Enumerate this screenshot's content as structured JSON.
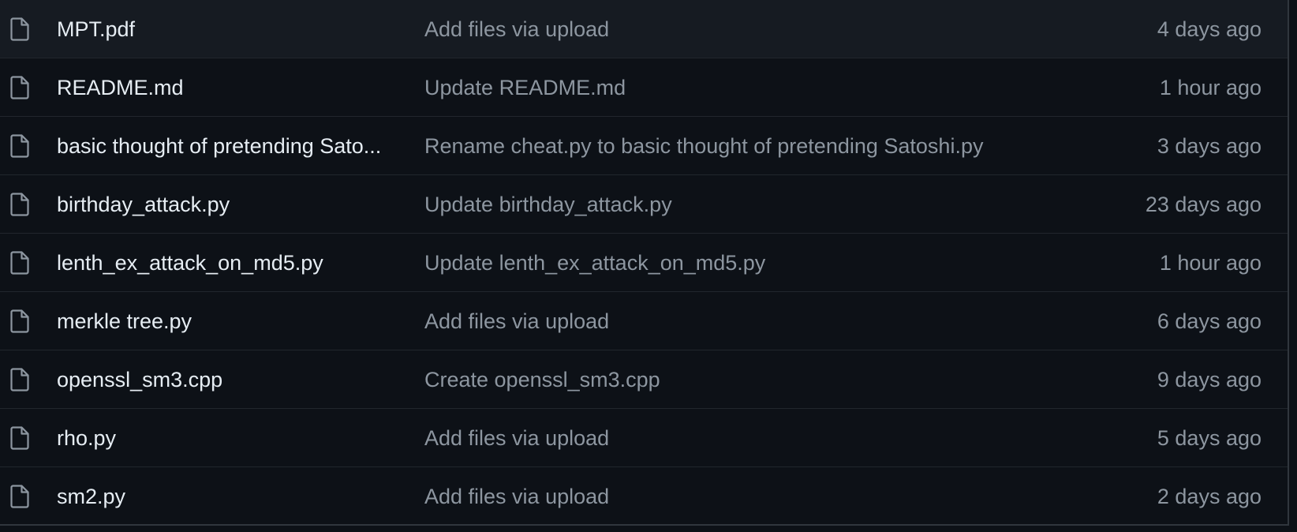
{
  "colors": {
    "background": "#0d1117",
    "row_border": "#21262d",
    "file_name": "#e6edf3",
    "muted_text": "#8d96a0",
    "icon": "#8d96a0"
  },
  "file_icon": "file-icon",
  "files": [
    {
      "name": "MPT.pdf",
      "commit": "Add files via upload",
      "age": "4 days ago"
    },
    {
      "name": "README.md",
      "commit": "Update README.md",
      "age": "1 hour ago"
    },
    {
      "name": "basic thought of pretending Sato...",
      "commit": "Rename cheat.py to basic thought of pretending Satoshi.py",
      "age": "3 days ago"
    },
    {
      "name": "birthday_attack.py",
      "commit": "Update birthday_attack.py",
      "age": "23 days ago"
    },
    {
      "name": "lenth_ex_attack_on_md5.py",
      "commit": "Update lenth_ex_attack_on_md5.py",
      "age": "1 hour ago"
    },
    {
      "name": "merkle tree.py",
      "commit": "Add files via upload",
      "age": "6 days ago"
    },
    {
      "name": "openssl_sm3.cpp",
      "commit": "Create openssl_sm3.cpp",
      "age": "9 days ago"
    },
    {
      "name": "rho.py",
      "commit": "Add files via upload",
      "age": "5 days ago"
    },
    {
      "name": "sm2.py",
      "commit": "Add files via upload",
      "age": "2 days ago"
    }
  ]
}
